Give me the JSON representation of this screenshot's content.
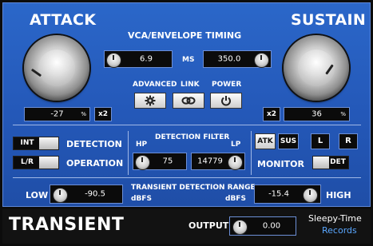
{
  "attack": {
    "title": "ATTACK",
    "value": "-27",
    "unit": "%",
    "x2_label": "x2"
  },
  "sustain": {
    "title": "SUSTAIN",
    "value": "36",
    "unit": "%",
    "x2_label": "x2"
  },
  "vca": {
    "title": "VCA/ENVELOPE TIMING",
    "left_value": "6.9",
    "unit": "MS",
    "right_value": "350.0"
  },
  "buttons": {
    "advanced": "ADVANCED",
    "link": "LINK",
    "power": "POWER"
  },
  "detection": {
    "int_label": "INT",
    "detection_label": "DETECTION",
    "lr_label": "L/R",
    "operation_label": "OPERATION"
  },
  "filter": {
    "title": "DETECTION FILTER",
    "hp": "HP",
    "lp": "LP",
    "hp_value": "75",
    "lp_value": "14779"
  },
  "monitor": {
    "atk": "ATK",
    "sus": "SUS",
    "l": "L",
    "r": "R",
    "det": "DET",
    "label": "MONITOR"
  },
  "range": {
    "low_label": "LOW",
    "low_value": "-90.5",
    "title": "TRANSIENT DETECTION RANGE",
    "dbfs_left": "dBFS",
    "dbfs_right": "dBFS",
    "high_value": "-15.4",
    "high_label": "HIGH"
  },
  "footer": {
    "brand": "TRANSIENT",
    "output_label": "OUTPUT",
    "output_value": "0.00",
    "company_line1": "Sleepy-Time",
    "company_line2": "Records"
  },
  "colors": {
    "panel": "#2458b8",
    "accent": "#5aa7ff",
    "field_bg": "#0b0b0b"
  }
}
